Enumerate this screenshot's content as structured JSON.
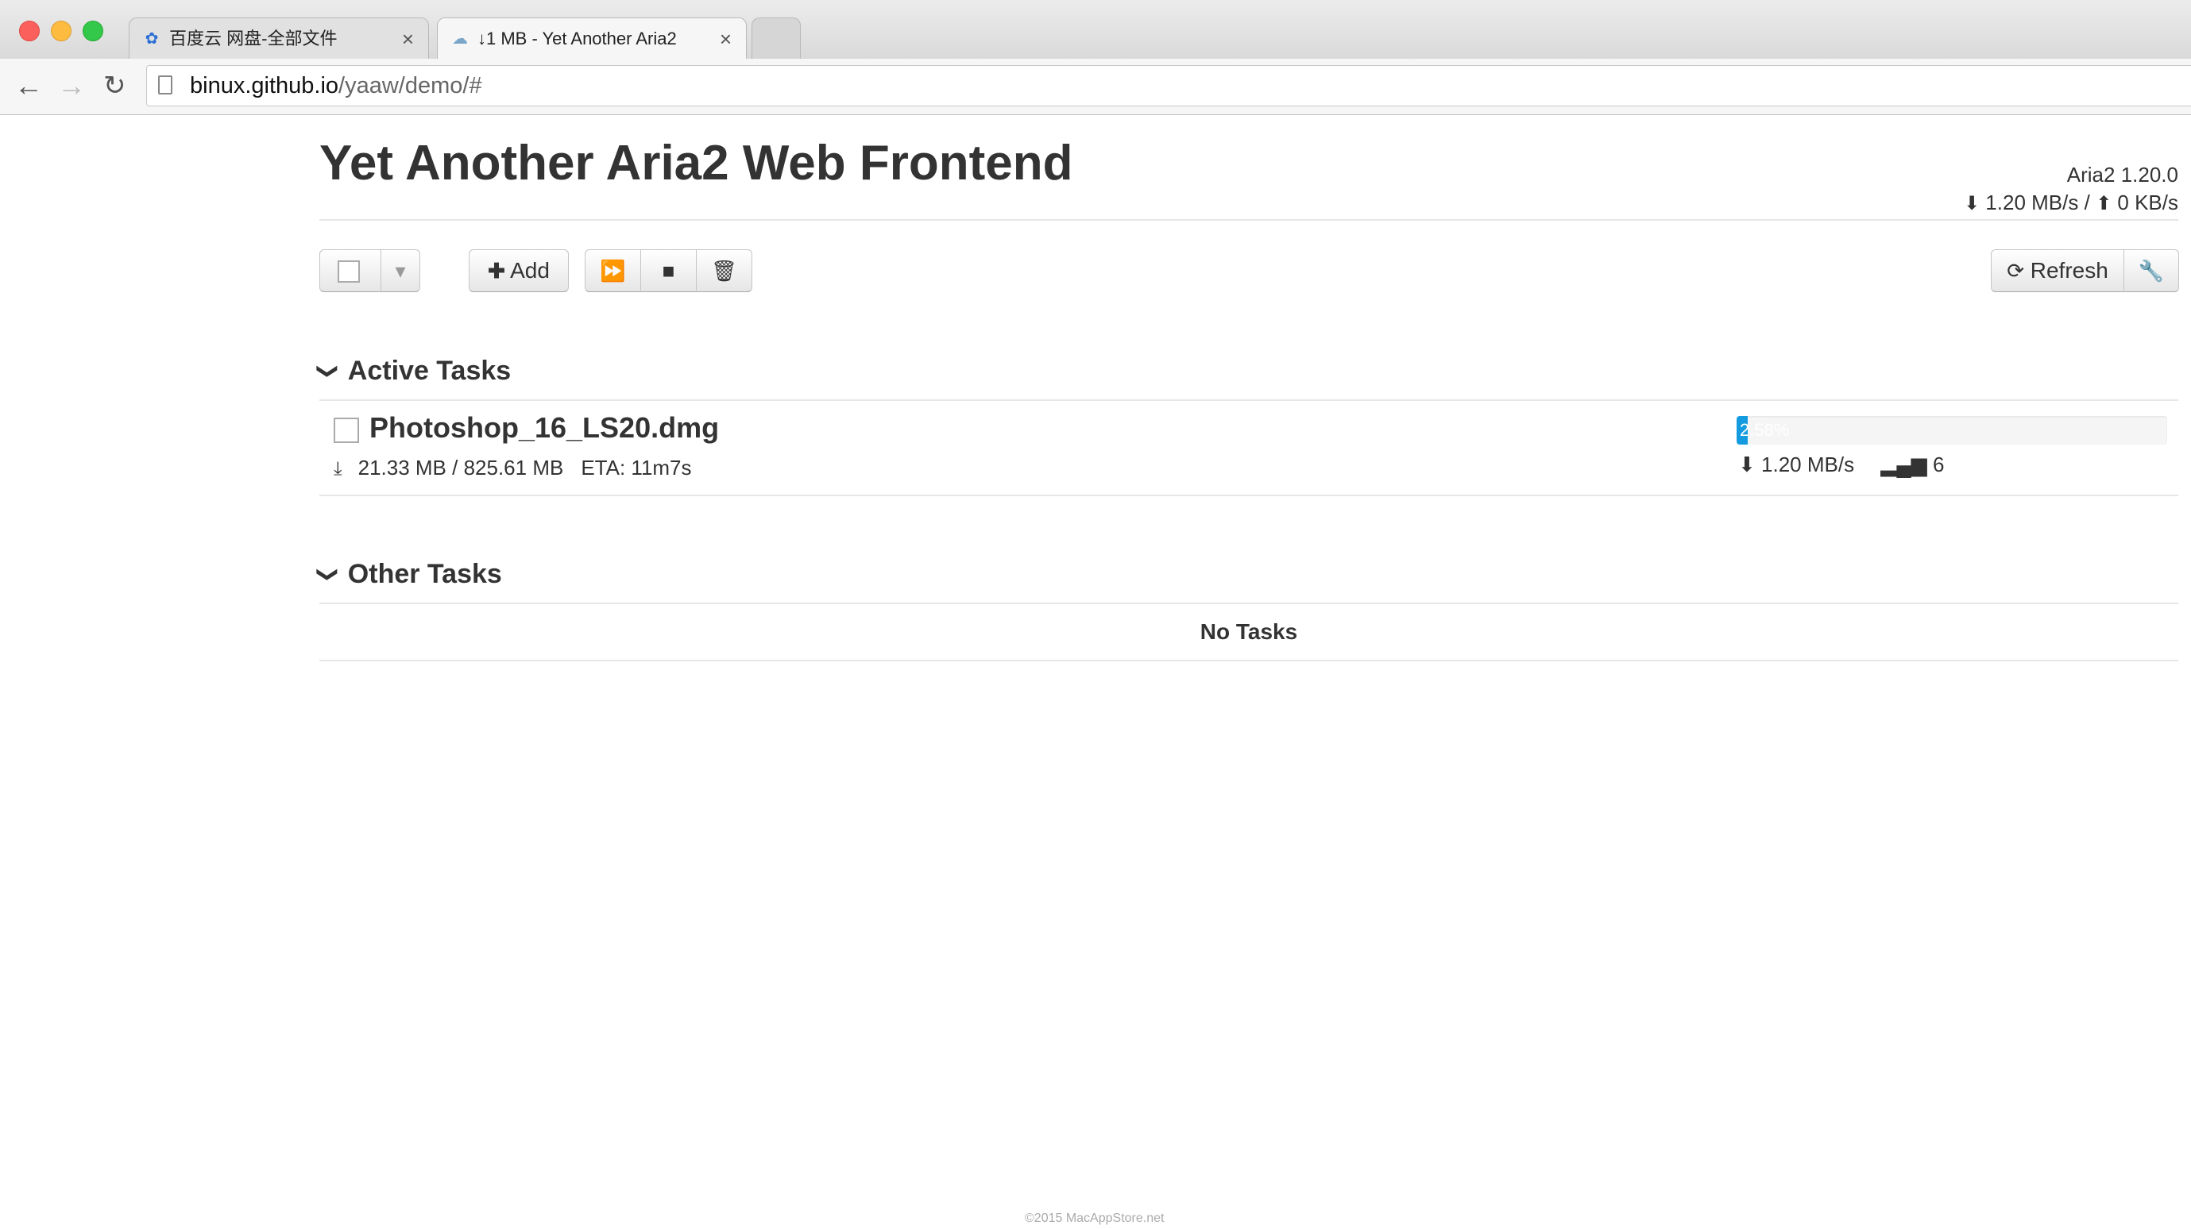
{
  "browser": {
    "tabs": [
      {
        "label": "百度云 网盘-全部文件",
        "icon": "baidu-cloud-icon",
        "close": "×"
      },
      {
        "label": "↓1 MB - Yet Another Aria2",
        "icon": "cloud-icon",
        "close": "×"
      }
    ],
    "url_host": "binux.github.io",
    "url_path": "/yaaw/demo/#"
  },
  "header": {
    "title": "Yet Another Aria2 Web Frontend",
    "version": "Aria2 1.20.0",
    "download_speed": "1.20 MB/s",
    "separator": "/",
    "upload_speed": "0 KB/s"
  },
  "toolbar": {
    "add_label": "Add",
    "refresh_label": "Refresh"
  },
  "sections": {
    "active": {
      "title": "Active Tasks"
    },
    "other": {
      "title": "Other Tasks",
      "empty_text": "No Tasks"
    }
  },
  "tasks": [
    {
      "name": "Photoshop_16_LS20.dmg",
      "size": "21.33 MB / 825.61 MB",
      "eta": "ETA: 11m7s",
      "progress_label": "2.58%",
      "progress": 0.0258,
      "speed": "1.20 MB/s",
      "connections": "6"
    }
  ],
  "footer": "©2015 MacAppStore.net",
  "colors": {
    "progress": "#149bdf",
    "text": "#333333"
  }
}
